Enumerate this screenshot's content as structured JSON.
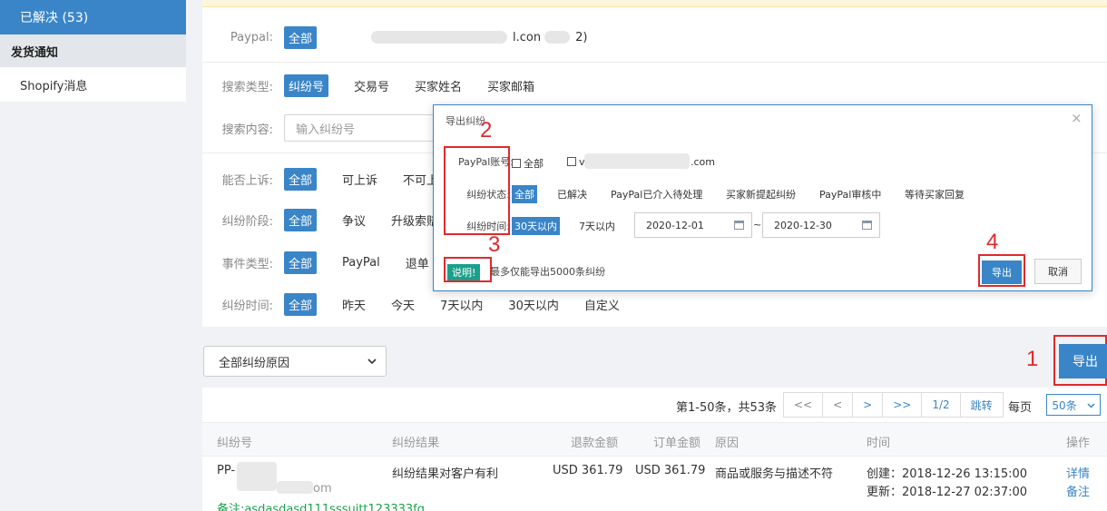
{
  "sidebar": {
    "active_item": "已解决 (53)",
    "group_label": "发货通知",
    "item": "Shopify消息"
  },
  "filters": {
    "paypal": {
      "label": "Paypal:",
      "all": "全部",
      "account_suffix": "l.con",
      "account_tail": "2)"
    },
    "search_type": {
      "label": "搜索类型:",
      "options": [
        "纠纷号",
        "交易号",
        "买家姓名",
        "买家邮箱"
      ]
    },
    "search_content": {
      "label": "搜索内容:",
      "placeholder": "输入纠纷号"
    },
    "appealable": {
      "label": "能否上诉:",
      "options": [
        "全部",
        "可上诉",
        "不可上"
      ]
    },
    "stage": {
      "label": "纠纷阶段:",
      "options": [
        "全部",
        "争议",
        "升级索赔"
      ]
    },
    "event_type": {
      "label": "事件类型:",
      "options": [
        "全部",
        "PayPal",
        "退单"
      ]
    },
    "dispute_time": {
      "label": "纠纷时间:",
      "options": [
        "全部",
        "昨天",
        "今天",
        "7天以内",
        "30天以内",
        "自定义"
      ]
    }
  },
  "reason_select": {
    "value": "全部纠纷原因"
  },
  "export_button": "导出",
  "annotations": {
    "n1": "1",
    "n2": "2",
    "n3": "3",
    "n4": "4"
  },
  "pager": {
    "info": "第1-50条，共53条",
    "buttons": [
      "<<",
      "<",
      ">",
      ">>",
      "1/2",
      "跳转"
    ],
    "per_page_label": "每页",
    "per_page_value": "50条"
  },
  "table": {
    "columns": [
      "纠纷号",
      "纠纷结果",
      "退款金额",
      "订单金额",
      "原因",
      "时间",
      "操作"
    ],
    "row": {
      "id_prefix": "PP-",
      "id_suffix": "om",
      "result": "纠纷结果对客户有利",
      "refund": "USD 361.79",
      "order": "USD 361.79",
      "reason": "商品或服务与描述不符",
      "created": "创建：2018-12-26 13:15:00",
      "updated": "更新：2018-12-27 02:37:00",
      "action_detail": "详情",
      "action_note": "备注",
      "note": "备注:asdasdasd111sssuitt123333fg"
    }
  },
  "modal": {
    "title": "导出纠纷",
    "close": "×",
    "account_label": "PayPal账号:",
    "account_all": "全部",
    "account_prefix": "v",
    "account_suffix": ".com",
    "status_label": "纠纷状态:",
    "status_options": [
      "全部",
      "已解决",
      "PayPal已介入待处理",
      "买家新提起纠纷",
      "PayPal审核中",
      "等待买家回复"
    ],
    "time_label": "纠纷时间:",
    "time_options": [
      "30天以内",
      "7天以内"
    ],
    "date_from": "2020-12-01",
    "date_sep": "~",
    "date_to": "2020-12-30",
    "note_badge": "说明!",
    "note_text": "最多仅能导出5000条纠纷",
    "export": "导出",
    "cancel": "取消"
  }
}
